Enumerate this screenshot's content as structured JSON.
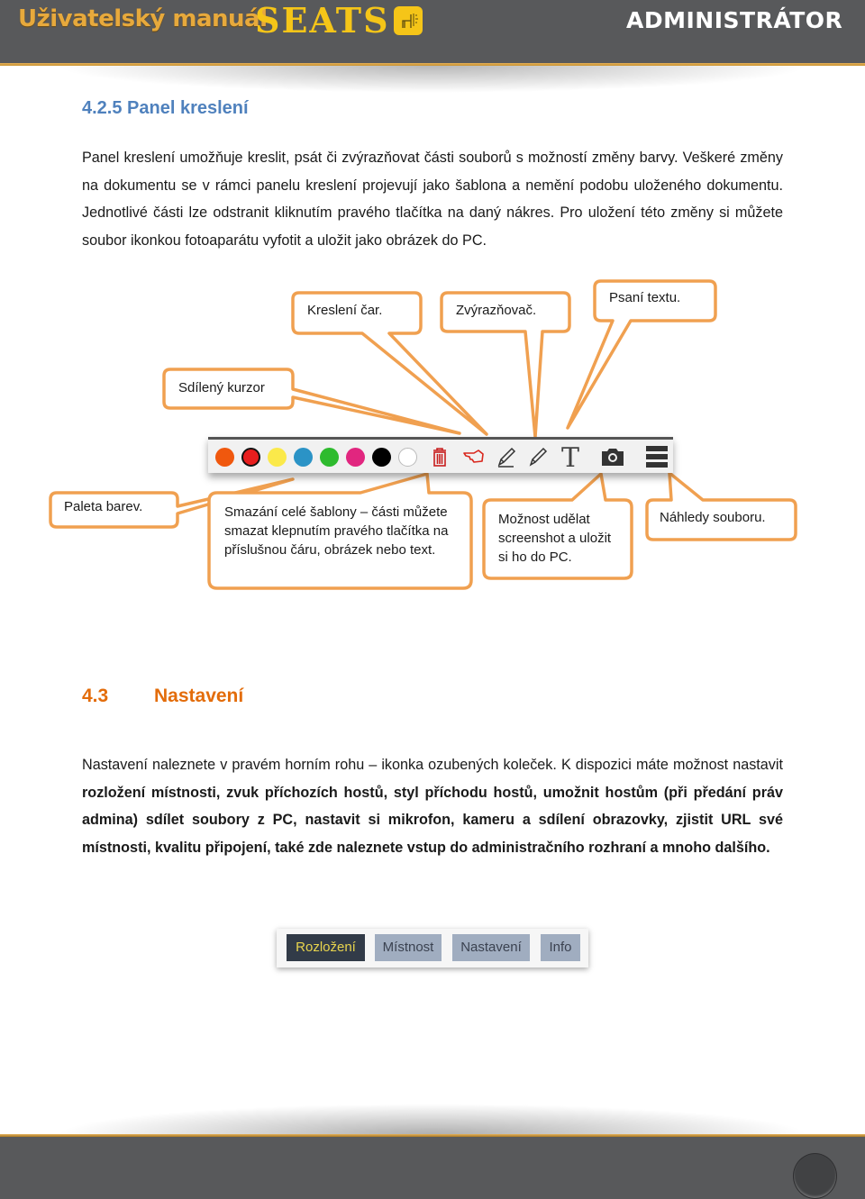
{
  "header": {
    "manual_title": "Uživatelský manuál",
    "brand": "SEATS",
    "brand_icon": "chair-icon",
    "role": "ADMINISTRÁTOR"
  },
  "section_425": {
    "heading": "4.2.5  Panel kreslení",
    "paragraph": "Panel kreslení umožňuje kreslit, psát či zvýrazňovat části souborů s možností změny barvy. Veškeré změny na dokumentu se v rámci panelu kreslení projevují jako šablona a nemění podobu uloženého dokumentu. Jednotlivé části lze odstranit kliknutím pravého tlačítka na daný nákres. Pro uložení této změny si můžete soubor ikonkou fotoaparátu vyfotit a uložit jako obrázek do PC."
  },
  "diagram": {
    "callouts": {
      "lines": "Kreslení čar.",
      "highlighter": "Zvýrazňovač.",
      "text": "Psaní textu.",
      "cursor": "Sdílený kurzor",
      "palette": "Paleta barev.",
      "delete": "Smazání celé šablony – části můžete smazat klepnutím pravého tlačítka na příslušnou čáru, obrázek nebo text.",
      "screenshot": "Možnost udělat screenshot a uložit si ho do PC.",
      "previews": "Náhledy souboru."
    },
    "callout_color": "#f0a050",
    "toolbar": {
      "colors": [
        "#f0580e",
        "#e81e1e",
        "#fbe94a",
        "#2b93c6",
        "#2ebb2e",
        "#e1267f",
        "#000000",
        "#ffffff"
      ],
      "selected_color_index": 1,
      "tools": [
        "trash-icon",
        "pointer-hand-icon",
        "pencil-icon",
        "highlighter-pen-icon",
        "text-tool-icon",
        "camera-icon",
        "menu-icon"
      ]
    }
  },
  "section_43": {
    "number": "4.3",
    "title": "Nastavení",
    "paragraph_parts": [
      {
        "text": "Nastavení naleznete v pravém horním rohu – ikonka ozubených koleček. K dispozici máte možnost nastavit ",
        "bold": false
      },
      {
        "text": "rozložení místnosti, zvuk příchozích hostů, styl příchodu hostů, umožnit hostům (při předání práv admina) sdílet soubory z PC, nastavit si mikrofon, kameru a sdílení obrazovky, zjistit URL své místnosti, kvalitu připojení, také zde naleznete vstup do administračního rozhraní a mnoho dalšího.",
        "bold": true
      }
    ]
  },
  "settings_tabs": {
    "tabs": [
      "Rozložení",
      "Místnost",
      "Nastavení",
      "Info"
    ],
    "active_index": 0
  }
}
